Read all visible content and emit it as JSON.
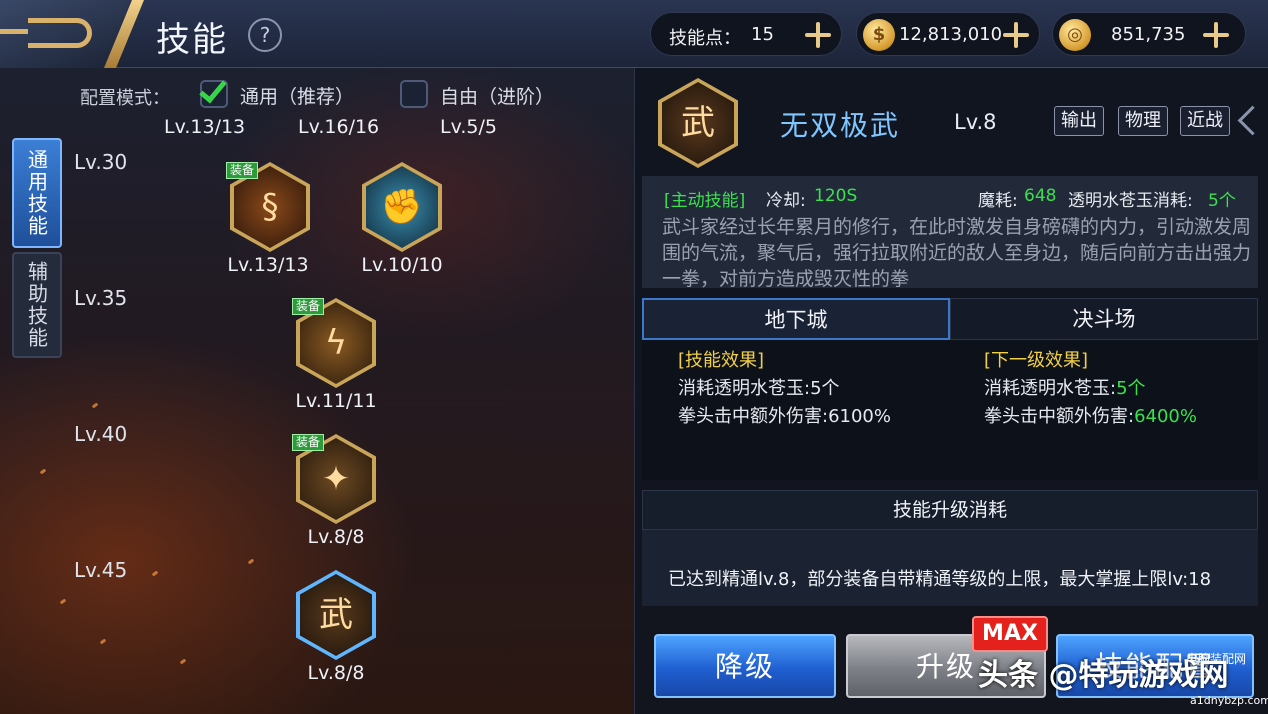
{
  "header": {
    "title": "技能",
    "help_label": "?",
    "skill_points_label": "技能点：",
    "skill_points_value": "15",
    "gold_value": "12,813,010",
    "coin_value": "851,735"
  },
  "side_tabs": [
    {
      "label": "通用技能",
      "active": true
    },
    {
      "label": "辅助技能",
      "active": false
    }
  ],
  "mode": {
    "label": "配置模式：",
    "options": [
      {
        "label": "通用（推荐）",
        "checked": true
      },
      {
        "label": "自由（进阶）",
        "checked": false
      }
    ],
    "counts": [
      "Lv.13/13",
      "Lv.16/16",
      "Lv.5/5"
    ]
  },
  "tree": {
    "rows": [
      "Lv.30",
      "Lv.35",
      "Lv.40",
      "Lv.45"
    ],
    "equip_label": "装备",
    "skills": [
      {
        "level": "Lv.13/13",
        "equipped": true,
        "icon": "whirl-icon"
      },
      {
        "level": "Lv.10/10",
        "equipped": false,
        "icon": "fist-icon"
      },
      {
        "level": "Lv.11/11",
        "equipped": true,
        "icon": "lightning-icon"
      },
      {
        "level": "Lv.8/8",
        "equipped": true,
        "icon": "kick-icon"
      },
      {
        "level": "Lv.8/8",
        "equipped": false,
        "icon": "martial-art-icon",
        "selected": true
      }
    ]
  },
  "detail": {
    "name": "无双极武",
    "level": "Lv.8",
    "tags": [
      "输出",
      "物理",
      "近战"
    ],
    "type_label": "[主动技能]",
    "cooldown_label": "冷却:",
    "cooldown_value": "120S",
    "mp_label": "魔耗:",
    "mp_value": "648",
    "crystal_label": "透明水苍玉消耗:",
    "crystal_value": "5个",
    "description": "武斗家经过长年累月的修行，在此时激发自身磅礴的内力，引动激发周围的气流，聚气后，强行拉取附近的敌人至身边，随后向前方击出强力一拳，对前方造成毁灭性的拳",
    "tabs": [
      "地下城",
      "决斗场"
    ],
    "current_effect": {
      "title": "[技能效果]",
      "line1": "消耗透明水苍玉:5个",
      "line2": "拳头击中额外伤害:6100%"
    },
    "next_effect": {
      "title": "[下一级效果]",
      "line1_label": "消耗透明水苍玉:",
      "line1_value": "5个",
      "line2_label": "拳头击中额外伤害:",
      "line2_value": "6400%"
    },
    "cost_header": "技能升级消耗",
    "cost_text": "已达到精通lv.8，部分装备自带精通等级的上限，最大掌握上限lv:18"
  },
  "actions": {
    "downgrade": "降级",
    "upgrade": "升级",
    "config": "技能配置",
    "max_badge": "MAX"
  },
  "watermark": {
    "main": "头条 @特玩游戏网",
    "small_top": "电脑装配网",
    "small_bottom": "a1dnybzp.com"
  }
}
